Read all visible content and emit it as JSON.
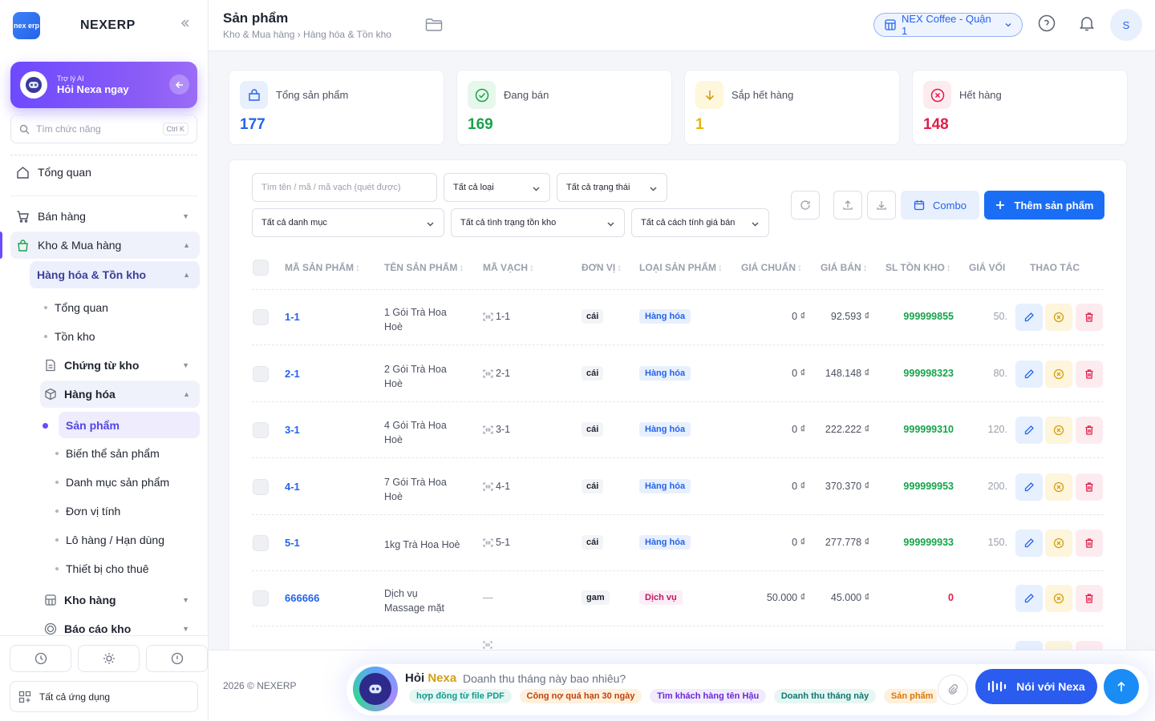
{
  "brand": {
    "logo_text": "nex erp",
    "name": "NEXERP"
  },
  "ai": {
    "subtitle": "Trợ lý AI",
    "title": "Hỏi Nexa ngay"
  },
  "side_search": {
    "placeholder": "Tìm chức năng",
    "shortcut": "Ctrl K"
  },
  "nav": {
    "overview": "Tổng quan",
    "sales": "Bán hàng",
    "inventory": "Kho & Mua hàng",
    "goods_stock": "Hàng hóa & Tồn kho",
    "sub_overview": "Tổng quan",
    "stock": "Tồn kho",
    "vouchers": "Chứng từ kho",
    "goods": "Hàng hóa",
    "products": "Sản phẩm",
    "variants": "Biến thể sản phẩm",
    "categories": "Danh mục sản phẩm",
    "units": "Đơn vị tính",
    "lots": "Lô hàng / Hạn dùng",
    "rental": "Thiết bị cho thuê",
    "warehouse": "Kho hàng",
    "report": "Báo cáo kho"
  },
  "all_apps": "Tất cả ứng dụng",
  "header": {
    "title": "Sản phẩm",
    "breadcrumb": "Kho & Mua hàng › Hàng hóa & Tồn kho",
    "store": "NEX Coffee - Quận 1",
    "avatar": "S"
  },
  "stats": [
    {
      "label": "Tổng sản phẩm",
      "value": "177",
      "color": "#2563eb"
    },
    {
      "label": "Đang bán",
      "value": "169",
      "color": "#16a34a"
    },
    {
      "label": "Sắp hết hàng",
      "value": "1",
      "color": "#eab308"
    },
    {
      "label": "Hết hàng",
      "value": "148",
      "color": "#e11d48"
    }
  ],
  "filters": {
    "search_placeholder": "Tìm tên / mã / mã vạch (quét được)",
    "type": "Tất cả loại",
    "status": "Tất cả trạng thái",
    "category": "Tất cả danh mục",
    "stock_status": "Tất cả tình trạng tồn kho",
    "price_method": "Tất cả cách tính giá bán"
  },
  "toolbar": {
    "combo": "Combo",
    "add": "Thêm sản phẩm"
  },
  "columns": {
    "code": "MÃ SẢN PHẨM",
    "name": "TÊN SẢN PHẨM",
    "barcode": "MÃ VẠCH",
    "unit": "ĐƠN VỊ",
    "type": "LOẠI SẢN PHẨM",
    "std_price": "GIÁ CHUẨN",
    "price": "GIÁ BÁN",
    "stock": "SL TỒN KHO",
    "cost": "GIÁ VỐI",
    "actions": "THAO TÁC"
  },
  "rows": [
    {
      "code": "1-1",
      "name": "1 Gói Trà Hoa Hoè",
      "barcode": "1-1",
      "unit": "cái",
      "type": "Hàng hóa",
      "std_price": "0 ₫",
      "price": "92.593 ₫",
      "stock": "999999855",
      "cost": "50."
    },
    {
      "code": "2-1",
      "name": "2 Gói Trà Hoa Hoè",
      "barcode": "2-1",
      "unit": "cái",
      "type": "Hàng hóa",
      "std_price": "0 ₫",
      "price": "148.148 ₫",
      "stock": "999998323",
      "cost": "80."
    },
    {
      "code": "3-1",
      "name": "4 Gói Trà Hoa Hoè",
      "barcode": "3-1",
      "unit": "cái",
      "type": "Hàng hóa",
      "std_price": "0 ₫",
      "price": "222.222 ₫",
      "stock": "999999310",
      "cost": "120."
    },
    {
      "code": "4-1",
      "name": "7 Gói Trà Hoa Hoè",
      "barcode": "4-1",
      "unit": "cái",
      "type": "Hàng hóa",
      "std_price": "0 ₫",
      "price": "370.370 ₫",
      "stock": "999999953",
      "cost": "200."
    },
    {
      "code": "5-1",
      "name": "1kg Trà Hoa Hoè",
      "barcode": "5-1",
      "unit": "cái",
      "type": "Hàng hóa",
      "std_price": "0 ₫",
      "price": "277.778 ₫",
      "stock": "999999933",
      "cost": "150."
    },
    {
      "code": "666666",
      "name": "Dịch vụ Massage mặt",
      "barcode": "—",
      "unit": "gam",
      "type": "Dịch vụ",
      "std_price": "50.000 ₫",
      "price": "45.000 ₫",
      "stock": "0",
      "cost": ""
    }
  ],
  "footer": {
    "copyright": "2026 © NEXERP",
    "ask": "Hỏi ",
    "ask_brand": "Nexa",
    "placeholder": "Doanh thu tháng này bao nhiêu?",
    "chips": [
      "hợp đồng từ file PDF",
      "Công nợ quá hạn 30 ngày",
      "Tìm khách hàng tên Hậu",
      "Doanh thu tháng này",
      "Sản phẩm"
    ],
    "talk": "Nói với Nexa"
  }
}
